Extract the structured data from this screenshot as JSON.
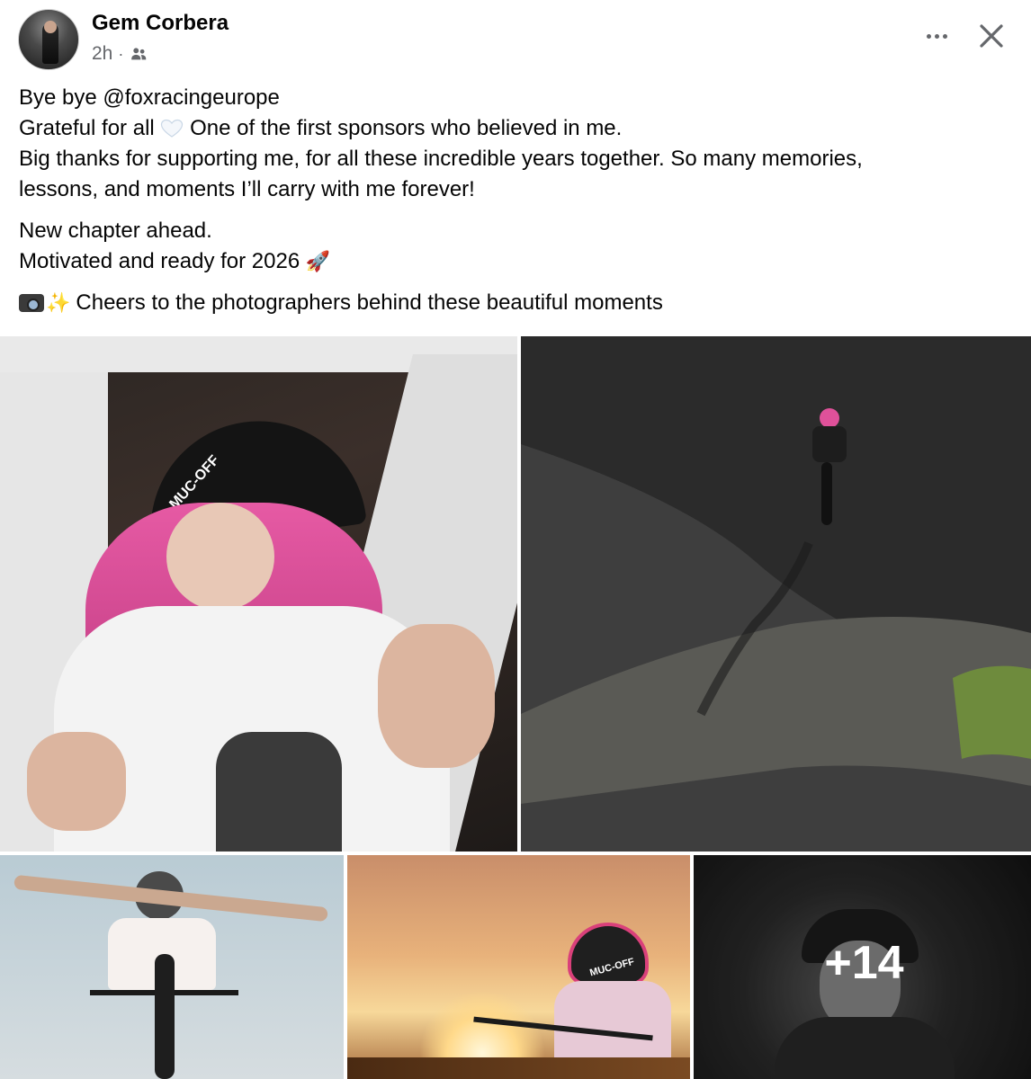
{
  "post": {
    "author": "Gem Corbera",
    "time": "2h",
    "audience_icon": "friends-icon",
    "more_icon": "more-options-icon",
    "close_icon": "close-icon",
    "text": {
      "line1": "Bye bye @foxracingeurope",
      "line2_before": "Grateful for all ",
      "line2_after": " One of the first sponsors who believed in me.",
      "line3": "Big thanks for supporting me, for all these incredible years together. So many memories,",
      "line4": "lessons, and moments I’ll carry with me forever!",
      "line5": "New chapter ahead.",
      "line6": "Motivated and ready for 2026 ",
      "line6_emoji": "🚀",
      "line7": "Cheers to the photographers behind these beautiful moments"
    }
  },
  "photos": {
    "photo1_alt": "Rider with pink hair wearing Muc-Off cap",
    "photo2_alt": "Rider descending dark slope",
    "photo3_alt": "Rider with arms outstretched on bike",
    "photo4_alt": "Rider in Muc-Off helmet at sunset",
    "photo5_alt": "Smiling rider in bucket hat",
    "cap_text": "MUC-OFF",
    "helmet_text": "MUC-OFF",
    "more_count": "+14"
  },
  "colors": {
    "text": "#050505",
    "secondary": "#65676b",
    "hair_pink": "#e0519a"
  }
}
